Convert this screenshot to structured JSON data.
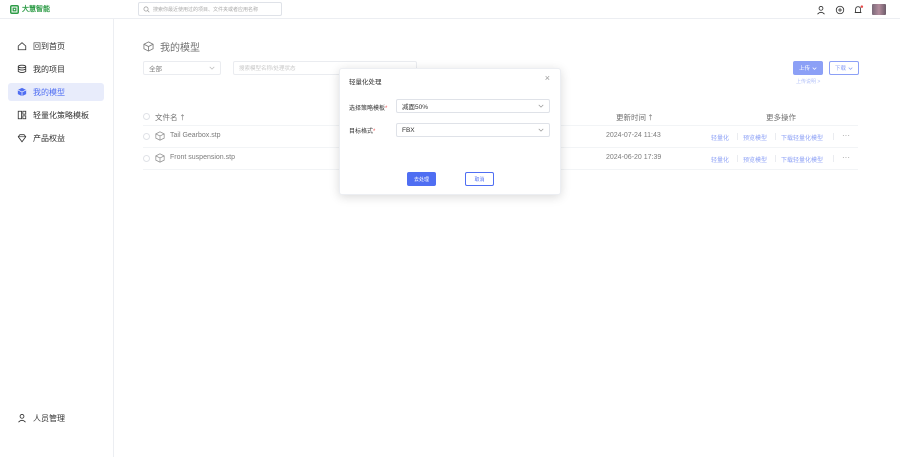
{
  "brand": {
    "name": "大慧智能",
    "color": "#2e9c47"
  },
  "accent_color": "#4f6ef2",
  "search": {
    "placeholder": "搜索你最近使用过的项目、文件夹或者应用名称"
  },
  "top_icons": [
    "user-icon",
    "plus-circle-icon",
    "bell-icon"
  ],
  "sidebar": {
    "items": [
      {
        "label": "回到首页",
        "icon": "home-icon",
        "active": false
      },
      {
        "label": "我的项目",
        "icon": "stack-icon",
        "active": false
      },
      {
        "label": "我的模型",
        "icon": "cube-icon",
        "active": true
      },
      {
        "label": "轻量化策略模板",
        "icon": "template-icon",
        "active": false
      },
      {
        "label": "产品权益",
        "icon": "diamond-icon",
        "active": false
      }
    ],
    "bottom_item": {
      "label": "人员管理",
      "icon": "person-icon"
    }
  },
  "page": {
    "title": "我的模型",
    "filter_value": "全部",
    "search_placeholder": "搜索模型名称/处理状态",
    "upload_label": "上传",
    "upload_link": "上传说明 >",
    "download_label": "下载"
  },
  "table": {
    "headers": {
      "name": "文件名",
      "updated": "更新时间",
      "actions": "更多操作"
    },
    "rows": [
      {
        "name": "Tail Gearbox.stp",
        "updated": "2024-07-24 11:43",
        "actions": [
          "轻量化",
          "预览模型",
          "下载轻量化模型"
        ],
        "more": "···"
      },
      {
        "name": "Front suspension.stp",
        "updated": "2024-06-20 17:39",
        "actions": [
          "轻量化",
          "预览模型",
          "下载轻量化模型"
        ],
        "more": "···"
      }
    ]
  },
  "modal": {
    "title": "轻量化处理",
    "close": "×",
    "fields": [
      {
        "label": "选择策略模板",
        "required": "*",
        "value": "减面50%"
      },
      {
        "label": "目标格式",
        "required": "*",
        "value": "FBX"
      }
    ],
    "confirm_label": "去处理",
    "cancel_label": "取消"
  }
}
